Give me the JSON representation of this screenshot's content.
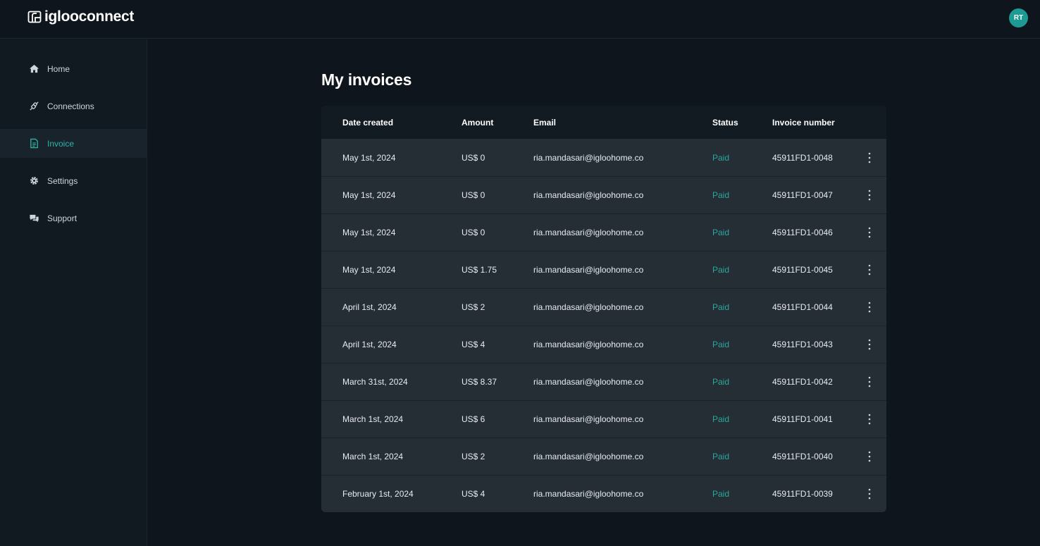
{
  "brand": {
    "name": "iglooconnect"
  },
  "user": {
    "initials": "RT"
  },
  "colors": {
    "accent": "#2fb3aa",
    "status_paid": "#2aa89f",
    "avatar": "#1d9a94"
  },
  "sidebar": {
    "items": [
      {
        "label": "Home",
        "icon": "home-icon"
      },
      {
        "label": "Connections",
        "icon": "connections-icon"
      },
      {
        "label": "Invoice",
        "icon": "invoice-icon",
        "active": true
      },
      {
        "label": "Settings",
        "icon": "gear-icon"
      },
      {
        "label": "Support",
        "icon": "support-chat-icon"
      }
    ]
  },
  "page": {
    "title": "My invoices"
  },
  "table": {
    "headers": {
      "date": "Date created",
      "amount": "Amount",
      "email": "Email",
      "status": "Status",
      "invoice": "Invoice number"
    },
    "rows": [
      {
        "date": "May 1st, 2024",
        "amount": "US$ 0",
        "email": "ria.mandasari@igloohome.co",
        "status": "Paid",
        "invoice": "45911FD1-0048"
      },
      {
        "date": "May 1st, 2024",
        "amount": "US$ 0",
        "email": "ria.mandasari@igloohome.co",
        "status": "Paid",
        "invoice": "45911FD1-0047"
      },
      {
        "date": "May 1st, 2024",
        "amount": "US$ 0",
        "email": "ria.mandasari@igloohome.co",
        "status": "Paid",
        "invoice": "45911FD1-0046"
      },
      {
        "date": "May 1st, 2024",
        "amount": "US$ 1.75",
        "email": "ria.mandasari@igloohome.co",
        "status": "Paid",
        "invoice": "45911FD1-0045"
      },
      {
        "date": "April 1st, 2024",
        "amount": "US$ 2",
        "email": "ria.mandasari@igloohome.co",
        "status": "Paid",
        "invoice": "45911FD1-0044"
      },
      {
        "date": "April 1st, 2024",
        "amount": "US$ 4",
        "email": "ria.mandasari@igloohome.co",
        "status": "Paid",
        "invoice": "45911FD1-0043"
      },
      {
        "date": "March 31st, 2024",
        "amount": "US$ 8.37",
        "email": "ria.mandasari@igloohome.co",
        "status": "Paid",
        "invoice": "45911FD1-0042"
      },
      {
        "date": "March 1st, 2024",
        "amount": "US$ 6",
        "email": "ria.mandasari@igloohome.co",
        "status": "Paid",
        "invoice": "45911FD1-0041"
      },
      {
        "date": "March 1st, 2024",
        "amount": "US$ 2",
        "email": "ria.mandasari@igloohome.co",
        "status": "Paid",
        "invoice": "45911FD1-0040"
      },
      {
        "date": "February 1st, 2024",
        "amount": "US$ 4",
        "email": "ria.mandasari@igloohome.co",
        "status": "Paid",
        "invoice": "45911FD1-0039"
      }
    ]
  }
}
